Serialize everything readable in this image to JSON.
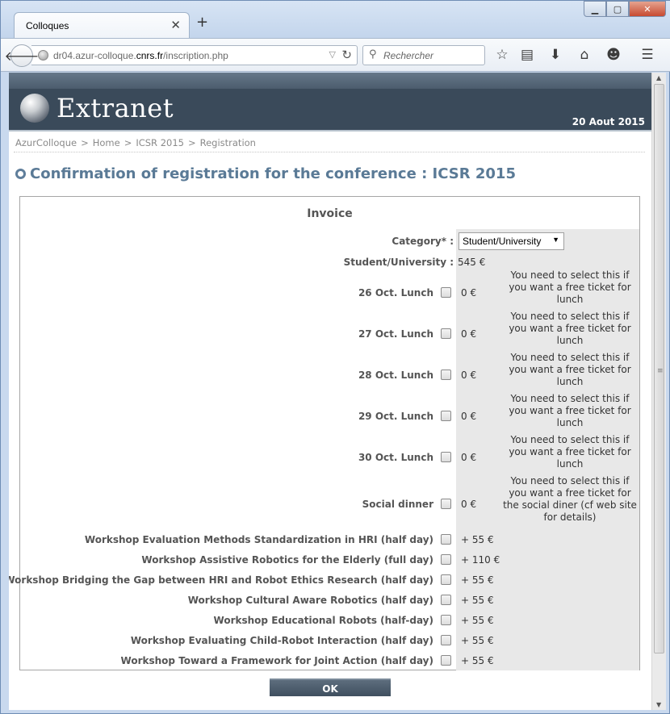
{
  "browser": {
    "tab_title": "Colloques",
    "url_prefix": "dr04.azur-colloque.",
    "url_host": "cnrs.fr",
    "url_path": "/inscription.php",
    "search_placeholder": "Rechercher"
  },
  "banner": {
    "logo_text": "Extranet",
    "date": "20 Aout 2015"
  },
  "breadcrumb": [
    "AzurColloque",
    "Home",
    "ICSR 2015",
    "Registration"
  ],
  "breadcrumb_separator": ">",
  "page_title": "Confirmation of registration for the conference : ICSR 2015",
  "invoice": {
    "heading": "Invoice",
    "category_label": "Category* :",
    "category_value": "Student/University",
    "base_label": "Student/University :",
    "base_price": "545 €",
    "rows": [
      {
        "label": "26 Oct. Lunch",
        "price": "0 €",
        "note": "You need to select this if you want a free ticket for lunch"
      },
      {
        "label": "27 Oct. Lunch",
        "price": "0 €",
        "note": "You need to select this if you want a free ticket for lunch"
      },
      {
        "label": "28 Oct. Lunch",
        "price": "0 €",
        "note": "You need to select this if you want a free ticket for lunch"
      },
      {
        "label": "29 Oct. Lunch",
        "price": "0 €",
        "note": "You need to select this if you want a free ticket for lunch"
      },
      {
        "label": "30 Oct. Lunch",
        "price": "0 €",
        "note": "You need to select this if you want a free ticket for lunch"
      },
      {
        "label": "Social dinner",
        "price": "0 €",
        "note": "You need to select this if you want a free ticket for the social diner (cf web site for details)"
      },
      {
        "label": "Workshop Evaluation Methods Standardization in HRI (half day)",
        "price": "+ 55 €",
        "note": ""
      },
      {
        "label": "Workshop Assistive Robotics for the Elderly (full day)",
        "price": "+ 110 €",
        "note": ""
      },
      {
        "label": "Workshop Bridging the Gap between HRI and Robot Ethics Research (half day)",
        "price": "+ 55 €",
        "note": ""
      },
      {
        "label": "Workshop Cultural Aware Robotics (half day)",
        "price": "+ 55 €",
        "note": ""
      },
      {
        "label": "Workshop Educational Robots (half-day)",
        "price": "+ 55 €",
        "note": ""
      },
      {
        "label": "Workshop Evaluating Child-Robot Interaction (half day)",
        "price": "+ 55 €",
        "note": ""
      },
      {
        "label": "Workshop Toward a Framework for Joint Action (half day)",
        "price": "+ 55 €",
        "note": ""
      }
    ]
  },
  "ok_label": "OK"
}
